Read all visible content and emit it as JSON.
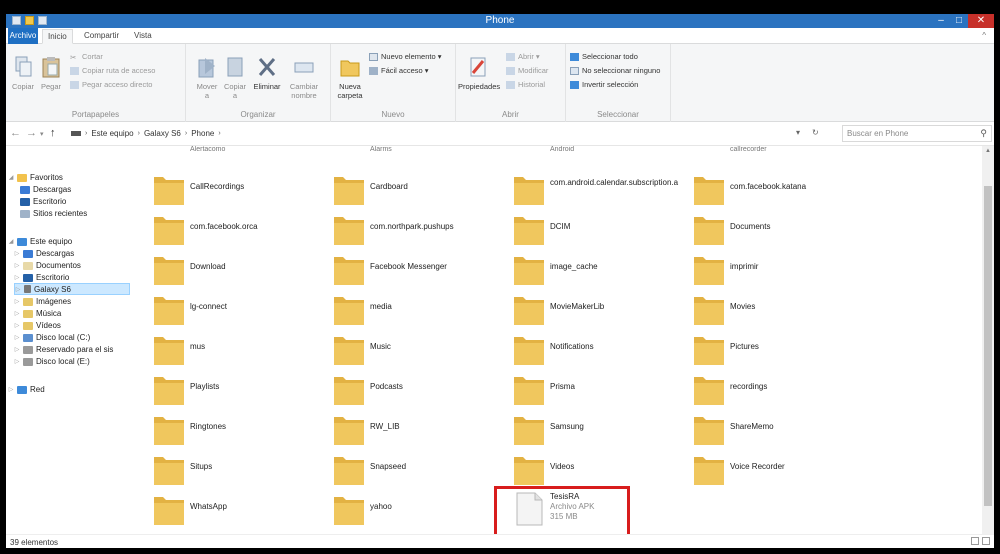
{
  "window": {
    "title": "Phone",
    "min_glyph": "–",
    "max_glyph": "□",
    "close_glyph": "✕"
  },
  "tabs": {
    "file": "Archivo",
    "home": "Inicio",
    "share": "Compartir",
    "view": "Vista",
    "expand_glyph": "^"
  },
  "ribbon": {
    "portapapeles": {
      "label": "Portapapeles",
      "copy": "Copiar",
      "paste": "Pegar",
      "cut": "Cortar",
      "copy_path": "Copiar ruta de acceso",
      "paste_shortcut": "Pegar acceso directo"
    },
    "organizar": {
      "label": "Organizar",
      "move": "Mover a",
      "copy_to": "Copiar a",
      "delete": "Eliminar",
      "rename": "Cambiar nombre"
    },
    "nuevo": {
      "label": "Nuevo",
      "new_folder": "Nueva carpeta",
      "new_item": "Nuevo elemento ▾",
      "easy_access": "Fácil acceso ▾"
    },
    "abrir": {
      "label": "Abrir",
      "properties": "Propiedades",
      "open": "Abrir ▾",
      "edit": "Modificar",
      "history": "Historial"
    },
    "seleccionar": {
      "label": "Seleccionar",
      "select_all": "Seleccionar todo",
      "select_none": "No seleccionar ninguno",
      "invert": "Invertir selección"
    }
  },
  "address": {
    "back": "←",
    "forward": "→",
    "recent": "▾",
    "up": "↑",
    "crumbs": [
      "Este equipo",
      "Galaxy S6",
      "Phone"
    ],
    "sep": "›",
    "dropdown": "▾",
    "refresh": "↻",
    "search_placeholder": "Buscar en Phone",
    "search_glyph": "⚲"
  },
  "navpane": {
    "favorites": "Favoritos",
    "fav_items": [
      "Descargas",
      "Escritorio",
      "Sitios recientes"
    ],
    "this_pc": "Este equipo",
    "pc_items": [
      "Descargas",
      "Documentos",
      "Escritorio",
      "Galaxy S6",
      "Imágenes",
      "Música",
      "Vídeos",
      "Disco local (C:)",
      "Reservado para el sis",
      "Disco local (E:)"
    ],
    "network": "Red",
    "expanded": "◢",
    "collapsed": "▷"
  },
  "cut_row": [
    "Alertacomo",
    "Alarms",
    "Android",
    "callrecorder"
  ],
  "items": [
    {
      "name": "CallRecordings"
    },
    {
      "name": "Cardboard"
    },
    {
      "name": "com.android.calendar.subscription.a"
    },
    {
      "name": "com.facebook.katana"
    },
    {
      "name": "com.facebook.orca"
    },
    {
      "name": "com.northpark.pushups"
    },
    {
      "name": "DCIM"
    },
    {
      "name": "Documents"
    },
    {
      "name": "Download"
    },
    {
      "name": "Facebook Messenger"
    },
    {
      "name": "image_cache"
    },
    {
      "name": "imprimir"
    },
    {
      "name": "lg-connect"
    },
    {
      "name": "media"
    },
    {
      "name": "MovieMakerLib"
    },
    {
      "name": "Movies"
    },
    {
      "name": "mus"
    },
    {
      "name": "Music"
    },
    {
      "name": "Notifications"
    },
    {
      "name": "Pictures"
    },
    {
      "name": "Playlists"
    },
    {
      "name": "Podcasts"
    },
    {
      "name": "Prisma"
    },
    {
      "name": "recordings"
    },
    {
      "name": "Ringtones"
    },
    {
      "name": "RW_LIB"
    },
    {
      "name": "Samsung"
    },
    {
      "name": "ShareMemo"
    },
    {
      "name": "Situps"
    },
    {
      "name": "Snapseed"
    },
    {
      "name": "Videos"
    },
    {
      "name": "Voice Recorder"
    },
    {
      "name": "WhatsApp"
    },
    {
      "name": "yahoo"
    }
  ],
  "apk_file": {
    "name": "TesisRA",
    "type": "Archivo APK",
    "size": "315 MB"
  },
  "status": {
    "count": "39 elementos"
  },
  "colors": {
    "titlebar": "#2b73c0",
    "folder": "#f0c75e",
    "highlight": "#d81d1d"
  }
}
